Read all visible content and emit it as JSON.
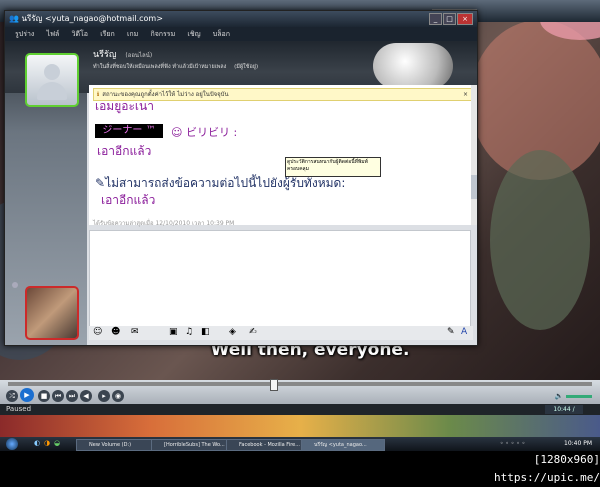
{
  "video": {
    "subtitle": "Well then, everyone."
  },
  "msn": {
    "title": "นรีรัญ <yuta_nagao@hotmail.com>",
    "menu": [
      "รูปร่าง",
      "ไฟล์",
      "วิดีโอ",
      "เรียก",
      "เกม",
      "กิจกรรม",
      "เชิญ",
      "บล็อก"
    ],
    "contact_name": "นรีรัญ",
    "contact_status": "(ออนไลน์)",
    "contact_message": "ทำในสิ่งที่ชอบให้เหมือนเพลงที่ฟัง ทำแล้วมีเป้าหมายเพลง",
    "contact_extra": "(มีผู้ใช้อยู่)",
    "info_bar": "สถานะของคุณถูกตั้งค่าไว้ให้ ไม่ว่าง อยู่ในปัจจุบัน",
    "chat_line1": "เอมยูอะเนา",
    "sticker_label": "ジーナー ™",
    "sticker_sub": "ビリビリ :",
    "chat_line2": "เอาอีกแล้ว",
    "error_line": "ไม่สามารถส่งข้อความต่อไปนี้ไปยังผู้รับทั้งหมด:",
    "chat_line3": "เอาอีกแล้ว",
    "tooltip": "ดูประวัติการสนทนากับผู้ติดต่อนี้ที่พิมพ์ครอบคลุม",
    "last_received": "ได้รับข้อความล่าสุดเมื่อ 12/10/2010 เวลา 10:39 PM"
  },
  "player": {
    "status": "Paused",
    "time": "10:44 / 23:34"
  },
  "taskbar": {
    "items": [
      "New Volume (D:)",
      "[HorribleSubs] The Wo...",
      "Facebook - Mozilla Fire...",
      "นรีรัญ <yuta_nagao..."
    ],
    "clock": "10:40 PM"
  },
  "footer": {
    "watermark": "[1280x960] https://upic.me/"
  },
  "colors": {
    "online_green": "#5fcf31",
    "busy_red": "#cc2a2a",
    "chat_purple": "#8a1c9a",
    "error_blue": "#223366"
  }
}
